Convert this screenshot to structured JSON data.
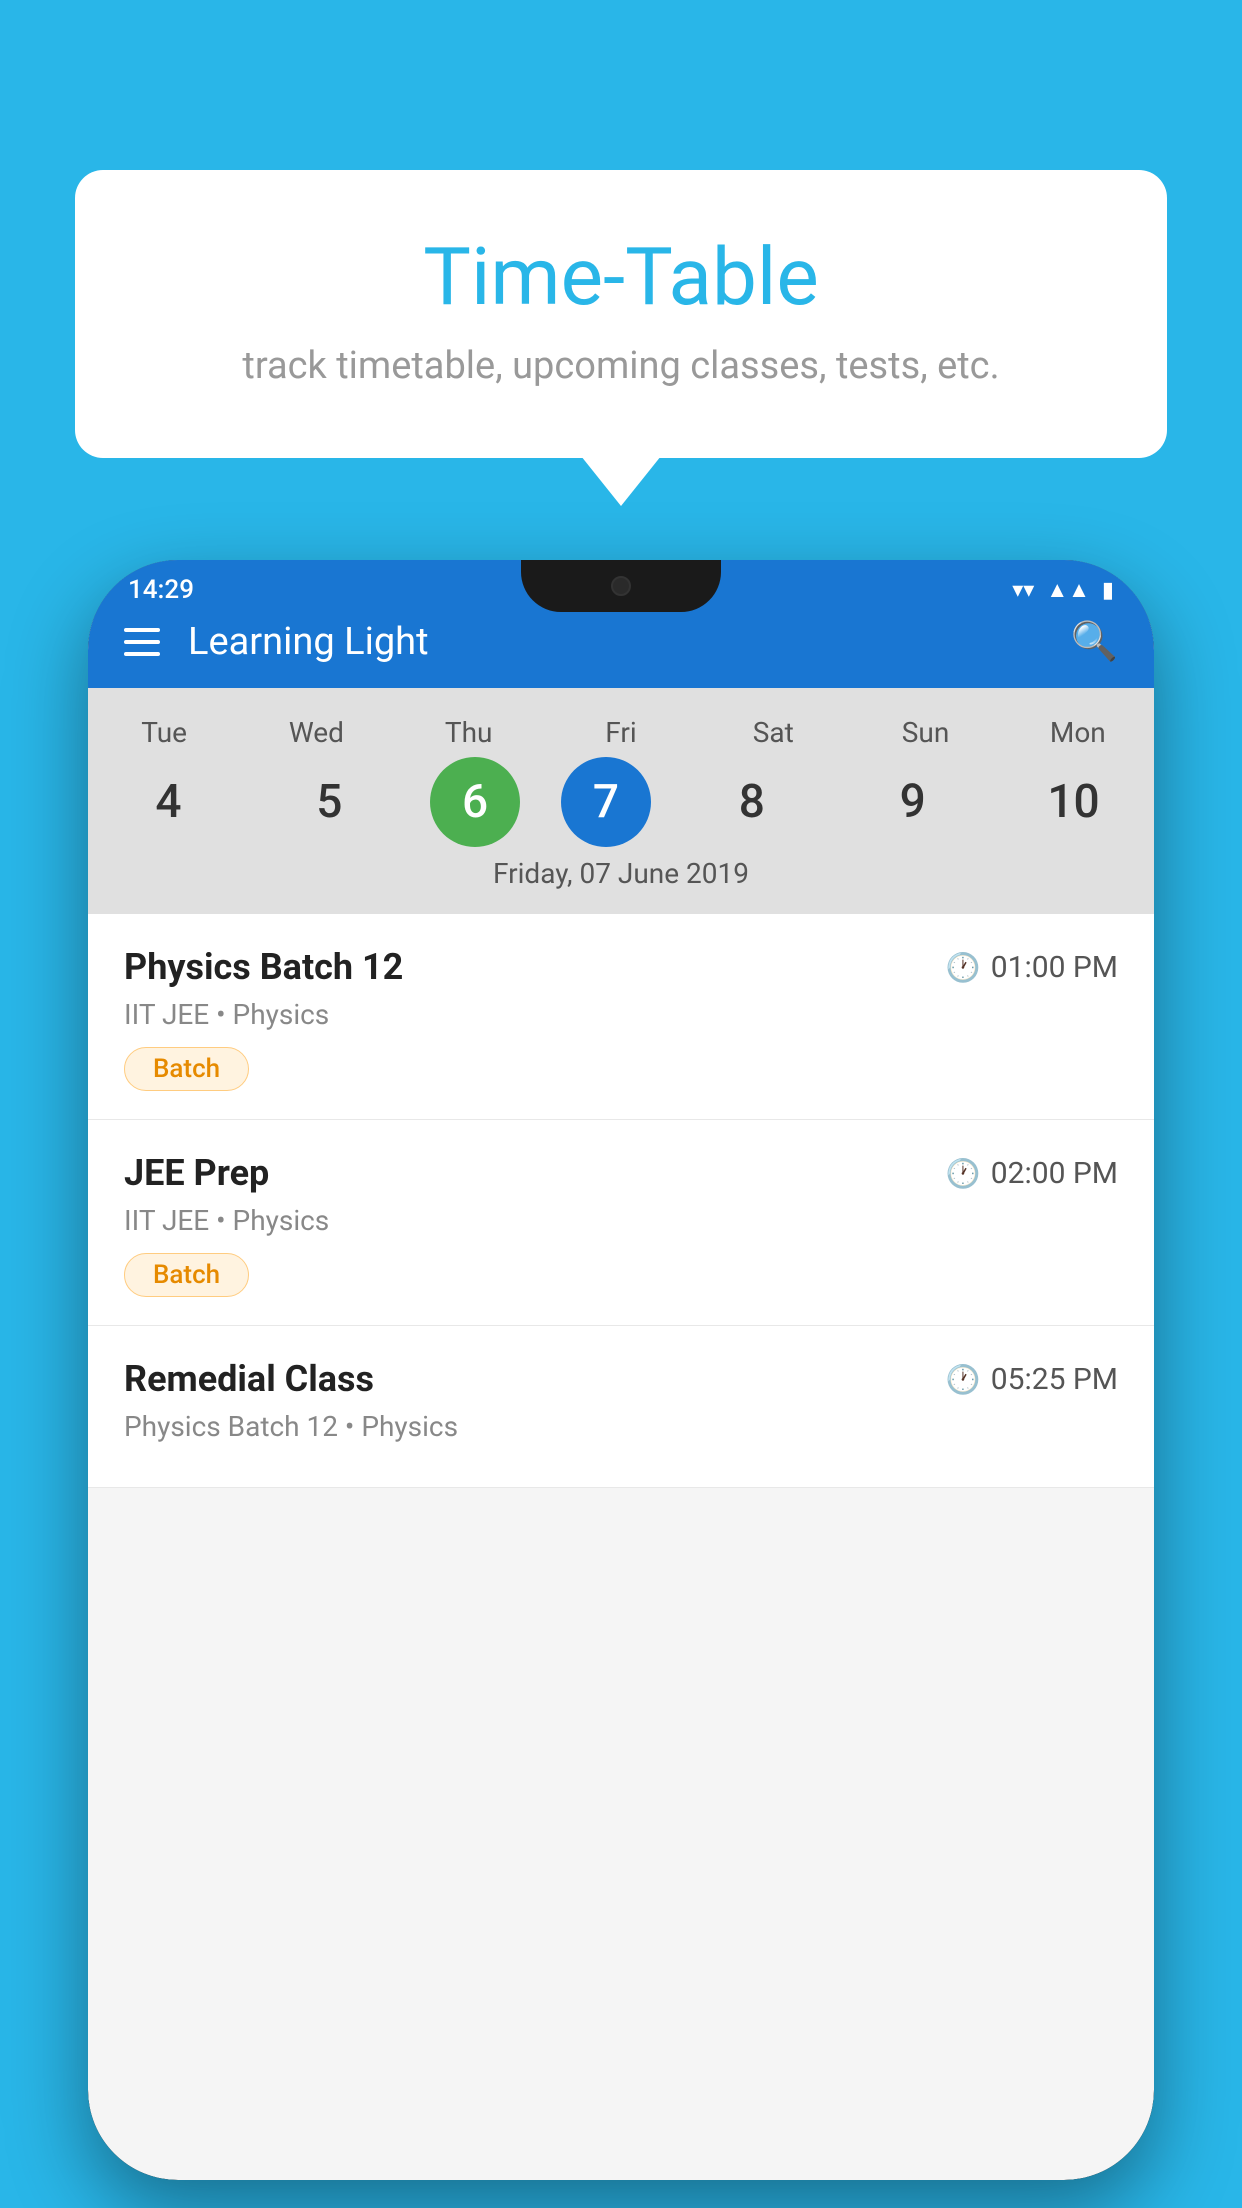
{
  "background_color": "#29b6e8",
  "bubble": {
    "title": "Time-Table",
    "subtitle": "track timetable, upcoming classes, tests, etc."
  },
  "phone": {
    "status_bar": {
      "time": "14:29"
    },
    "app_bar": {
      "title": "Learning Light"
    },
    "calendar": {
      "days": [
        {
          "name": "Tue",
          "num": "4",
          "state": "normal"
        },
        {
          "name": "Wed",
          "num": "5",
          "state": "normal"
        },
        {
          "name": "Thu",
          "num": "6",
          "state": "today"
        },
        {
          "name": "Fri",
          "num": "7",
          "state": "selected"
        },
        {
          "name": "Sat",
          "num": "8",
          "state": "normal"
        },
        {
          "name": "Sun",
          "num": "9",
          "state": "normal"
        },
        {
          "name": "Mon",
          "num": "10",
          "state": "normal"
        }
      ],
      "selected_date_label": "Friday, 07 June 2019"
    },
    "schedule": [
      {
        "title": "Physics Batch 12",
        "time": "01:00 PM",
        "meta": "IIT JEE • Physics",
        "tag": "Batch"
      },
      {
        "title": "JEE Prep",
        "time": "02:00 PM",
        "meta": "IIT JEE • Physics",
        "tag": "Batch"
      },
      {
        "title": "Remedial Class",
        "time": "05:25 PM",
        "meta": "Physics Batch 12 • Physics",
        "tag": ""
      }
    ]
  }
}
